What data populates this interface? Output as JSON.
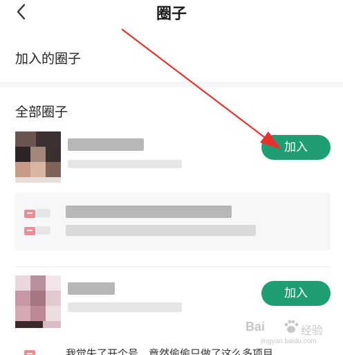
{
  "header": {
    "title": "圈子"
  },
  "sections": {
    "joined_title": "加入的圈子",
    "all_title": "全部圈子"
  },
  "circles": [
    {
      "join_label": "加入"
    },
    {
      "join_label": "加入"
    }
  ],
  "bottom_snippet": "我觉失了开个号，竟然偷偷只做了这么多项目",
  "watermark": {
    "brand": "Bai",
    "cn": "经验",
    "url": "jingyan.baidu.com"
  },
  "colors": {
    "accent": "#1f9e74",
    "annotation_arrow": "#e8302e",
    "tag_icon": "#f08b93"
  }
}
